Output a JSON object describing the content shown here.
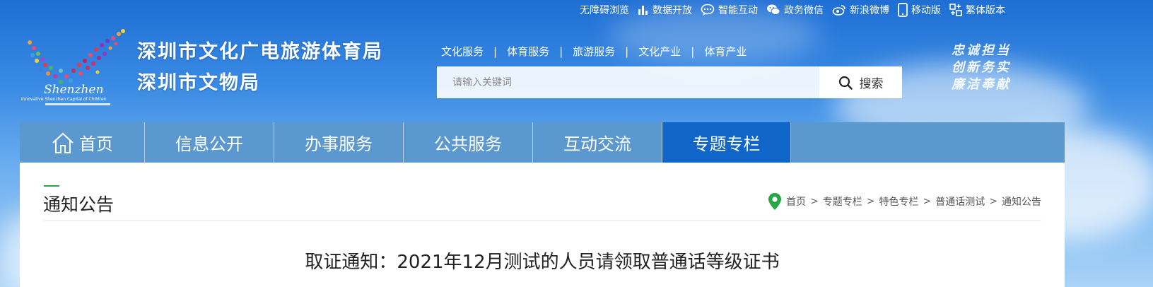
{
  "utility_bar": [
    {
      "label": "无障碍浏览",
      "icon": "none"
    },
    {
      "label": "数据开放",
      "icon": "bar-chart-icon"
    },
    {
      "label": "智能互动",
      "icon": "chat-bubble-icon"
    },
    {
      "label": "政务微信",
      "icon": "wechat-icon"
    },
    {
      "label": "新浪微博",
      "icon": "weibo-icon"
    },
    {
      "label": "移动版",
      "icon": "mobile-icon"
    },
    {
      "label": "繁体版本",
      "icon": "traditional-chinese-icon"
    }
  ],
  "logo": {
    "text": "Shenzhen",
    "tagline": "Innovative Shenzhen Capital of Children"
  },
  "org": {
    "line1": "深圳市文化广电旅游体育局",
    "line2": "深圳市文物局"
  },
  "subnav": [
    "文化服务",
    "体育服务",
    "旅游服务",
    "文化产业",
    "体育产业"
  ],
  "subnav_separator": "|",
  "search": {
    "placeholder": "请输入关键词",
    "button_label": "搜索"
  },
  "slogan": [
    "忠诚担当",
    "创新务实",
    "廉洁奉献"
  ],
  "main_nav": [
    {
      "label": "首页",
      "icon": "home-icon",
      "active": false
    },
    {
      "label": "信息公开",
      "active": false
    },
    {
      "label": "办事服务",
      "active": false
    },
    {
      "label": "公共服务",
      "active": false
    },
    {
      "label": "互动交流",
      "active": false
    },
    {
      "label": "专题专栏",
      "active": true
    }
  ],
  "page": {
    "section_title": "通知公告",
    "breadcrumb": [
      "首页",
      "专题专栏",
      "特色专栏",
      "普通话测试",
      "通知公告"
    ],
    "breadcrumb_separator": ">",
    "article_title": "取证通知：2021年12月测试的人员请领取普通话等级证书"
  },
  "colors": {
    "nav_bg": "#5b98cf",
    "nav_active": "#0f66c8",
    "accent_green": "#28a745"
  }
}
